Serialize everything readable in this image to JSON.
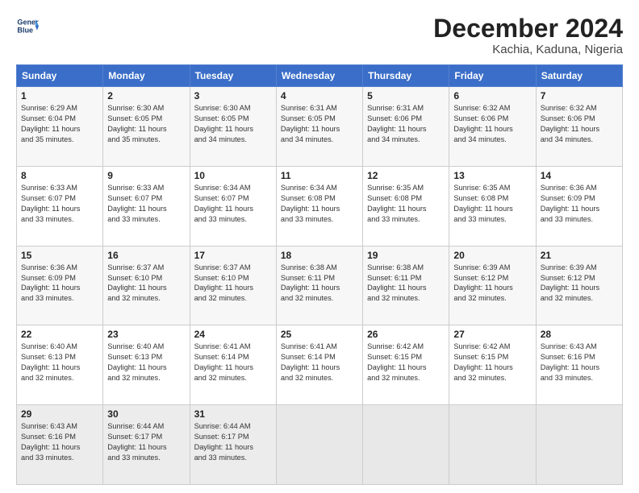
{
  "header": {
    "logo_line1": "General",
    "logo_line2": "Blue",
    "title": "December 2024",
    "subtitle": "Kachia, Kaduna, Nigeria"
  },
  "columns": [
    "Sunday",
    "Monday",
    "Tuesday",
    "Wednesday",
    "Thursday",
    "Friday",
    "Saturday"
  ],
  "weeks": [
    [
      {
        "day": "1",
        "info": "Sunrise: 6:29 AM\nSunset: 6:04 PM\nDaylight: 11 hours\nand 35 minutes."
      },
      {
        "day": "2",
        "info": "Sunrise: 6:30 AM\nSunset: 6:05 PM\nDaylight: 11 hours\nand 35 minutes."
      },
      {
        "day": "3",
        "info": "Sunrise: 6:30 AM\nSunset: 6:05 PM\nDaylight: 11 hours\nand 34 minutes."
      },
      {
        "day": "4",
        "info": "Sunrise: 6:31 AM\nSunset: 6:05 PM\nDaylight: 11 hours\nand 34 minutes."
      },
      {
        "day": "5",
        "info": "Sunrise: 6:31 AM\nSunset: 6:06 PM\nDaylight: 11 hours\nand 34 minutes."
      },
      {
        "day": "6",
        "info": "Sunrise: 6:32 AM\nSunset: 6:06 PM\nDaylight: 11 hours\nand 34 minutes."
      },
      {
        "day": "7",
        "info": "Sunrise: 6:32 AM\nSunset: 6:06 PM\nDaylight: 11 hours\nand 34 minutes."
      }
    ],
    [
      {
        "day": "8",
        "info": "Sunrise: 6:33 AM\nSunset: 6:07 PM\nDaylight: 11 hours\nand 33 minutes."
      },
      {
        "day": "9",
        "info": "Sunrise: 6:33 AM\nSunset: 6:07 PM\nDaylight: 11 hours\nand 33 minutes."
      },
      {
        "day": "10",
        "info": "Sunrise: 6:34 AM\nSunset: 6:07 PM\nDaylight: 11 hours\nand 33 minutes."
      },
      {
        "day": "11",
        "info": "Sunrise: 6:34 AM\nSunset: 6:08 PM\nDaylight: 11 hours\nand 33 minutes."
      },
      {
        "day": "12",
        "info": "Sunrise: 6:35 AM\nSunset: 6:08 PM\nDaylight: 11 hours\nand 33 minutes."
      },
      {
        "day": "13",
        "info": "Sunrise: 6:35 AM\nSunset: 6:08 PM\nDaylight: 11 hours\nand 33 minutes."
      },
      {
        "day": "14",
        "info": "Sunrise: 6:36 AM\nSunset: 6:09 PM\nDaylight: 11 hours\nand 33 minutes."
      }
    ],
    [
      {
        "day": "15",
        "info": "Sunrise: 6:36 AM\nSunset: 6:09 PM\nDaylight: 11 hours\nand 33 minutes."
      },
      {
        "day": "16",
        "info": "Sunrise: 6:37 AM\nSunset: 6:10 PM\nDaylight: 11 hours\nand 32 minutes."
      },
      {
        "day": "17",
        "info": "Sunrise: 6:37 AM\nSunset: 6:10 PM\nDaylight: 11 hours\nand 32 minutes."
      },
      {
        "day": "18",
        "info": "Sunrise: 6:38 AM\nSunset: 6:11 PM\nDaylight: 11 hours\nand 32 minutes."
      },
      {
        "day": "19",
        "info": "Sunrise: 6:38 AM\nSunset: 6:11 PM\nDaylight: 11 hours\nand 32 minutes."
      },
      {
        "day": "20",
        "info": "Sunrise: 6:39 AM\nSunset: 6:12 PM\nDaylight: 11 hours\nand 32 minutes."
      },
      {
        "day": "21",
        "info": "Sunrise: 6:39 AM\nSunset: 6:12 PM\nDaylight: 11 hours\nand 32 minutes."
      }
    ],
    [
      {
        "day": "22",
        "info": "Sunrise: 6:40 AM\nSunset: 6:13 PM\nDaylight: 11 hours\nand 32 minutes."
      },
      {
        "day": "23",
        "info": "Sunrise: 6:40 AM\nSunset: 6:13 PM\nDaylight: 11 hours\nand 32 minutes."
      },
      {
        "day": "24",
        "info": "Sunrise: 6:41 AM\nSunset: 6:14 PM\nDaylight: 11 hours\nand 32 minutes."
      },
      {
        "day": "25",
        "info": "Sunrise: 6:41 AM\nSunset: 6:14 PM\nDaylight: 11 hours\nand 32 minutes."
      },
      {
        "day": "26",
        "info": "Sunrise: 6:42 AM\nSunset: 6:15 PM\nDaylight: 11 hours\nand 32 minutes."
      },
      {
        "day": "27",
        "info": "Sunrise: 6:42 AM\nSunset: 6:15 PM\nDaylight: 11 hours\nand 32 minutes."
      },
      {
        "day": "28",
        "info": "Sunrise: 6:43 AM\nSunset: 6:16 PM\nDaylight: 11 hours\nand 33 minutes."
      }
    ],
    [
      {
        "day": "29",
        "info": "Sunrise: 6:43 AM\nSunset: 6:16 PM\nDaylight: 11 hours\nand 33 minutes."
      },
      {
        "day": "30",
        "info": "Sunrise: 6:44 AM\nSunset: 6:17 PM\nDaylight: 11 hours\nand 33 minutes."
      },
      {
        "day": "31",
        "info": "Sunrise: 6:44 AM\nSunset: 6:17 PM\nDaylight: 11 hours\nand 33 minutes."
      },
      {
        "day": "",
        "info": ""
      },
      {
        "day": "",
        "info": ""
      },
      {
        "day": "",
        "info": ""
      },
      {
        "day": "",
        "info": ""
      }
    ]
  ]
}
